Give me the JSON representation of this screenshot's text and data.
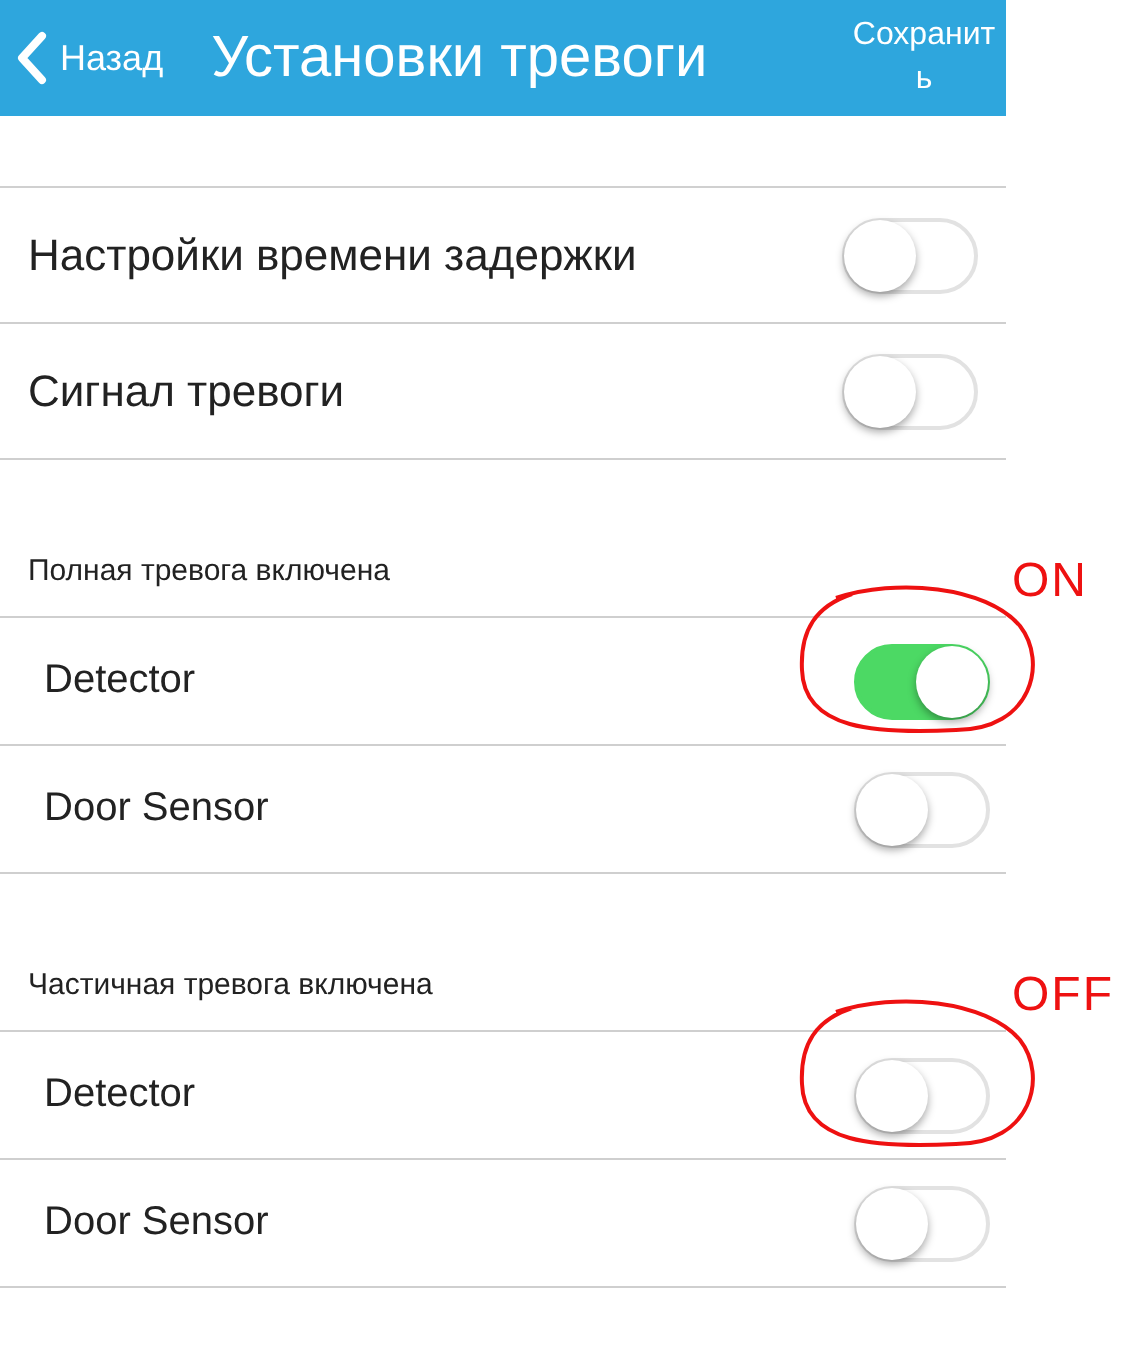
{
  "header": {
    "back": "Назад",
    "title": "Установки тревоги",
    "save": "Сохранить"
  },
  "settings": [
    {
      "label": "Настройки времени задержки",
      "on": false
    },
    {
      "label": "Сигнал тревоги",
      "on": false
    }
  ],
  "sections": [
    {
      "title": "Полная тревога включена",
      "items": [
        {
          "label": "Detector",
          "on": true,
          "note": "ON"
        },
        {
          "label": "Door Sensor",
          "on": false
        }
      ]
    },
    {
      "title": "Частичная тревога включена",
      "items": [
        {
          "label": "Detector",
          "on": false,
          "note": "OFF"
        },
        {
          "label": "Door Sensor",
          "on": false
        }
      ]
    }
  ]
}
